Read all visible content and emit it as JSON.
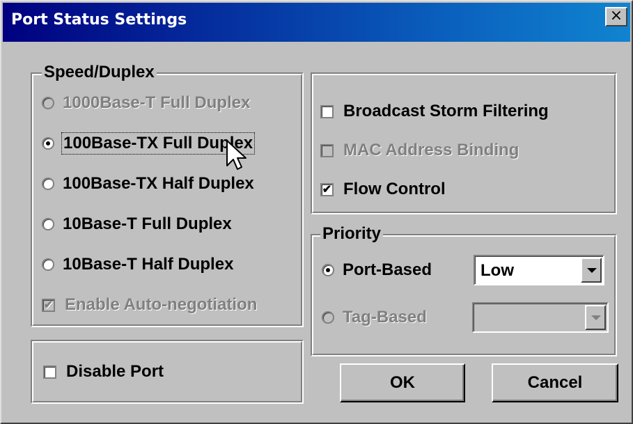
{
  "window": {
    "title": "Port  Status Settings",
    "close_glyph": "×"
  },
  "speed_duplex": {
    "legend": "Speed/Duplex",
    "options": [
      {
        "label": "1000Base-T Full Duplex",
        "selected": false,
        "enabled": false
      },
      {
        "label": "100Base-TX Full Duplex",
        "selected": true,
        "enabled": true
      },
      {
        "label": "100Base-TX Half Duplex",
        "selected": false,
        "enabled": true
      },
      {
        "label": "10Base-T Full Duplex",
        "selected": false,
        "enabled": true
      },
      {
        "label": "10Base-T Half Duplex",
        "selected": false,
        "enabled": true
      }
    ],
    "auto_negotiation": {
      "label": "Enable Auto-negotiation",
      "checked": true,
      "enabled": false
    }
  },
  "options": {
    "broadcast_storm": {
      "label": "Broadcast Storm Filtering",
      "checked": false,
      "enabled": true
    },
    "mac_binding": {
      "label": "MAC Address Binding",
      "checked": false,
      "enabled": false
    },
    "flow_control": {
      "label": "Flow Control",
      "checked": true,
      "enabled": true
    }
  },
  "priority": {
    "legend": "Priority",
    "port_based": {
      "label": "Port-Based",
      "selected": true,
      "value": "Low"
    },
    "tag_based": {
      "label": "Tag-Based",
      "selected": false,
      "enabled": false,
      "value": ""
    }
  },
  "disable_port": {
    "label": "Disable Port",
    "checked": false
  },
  "buttons": {
    "ok": "OK",
    "cancel": "Cancel"
  },
  "icons": {
    "checkmark": "✔",
    "cursor": "arrow-cursor-icon"
  }
}
